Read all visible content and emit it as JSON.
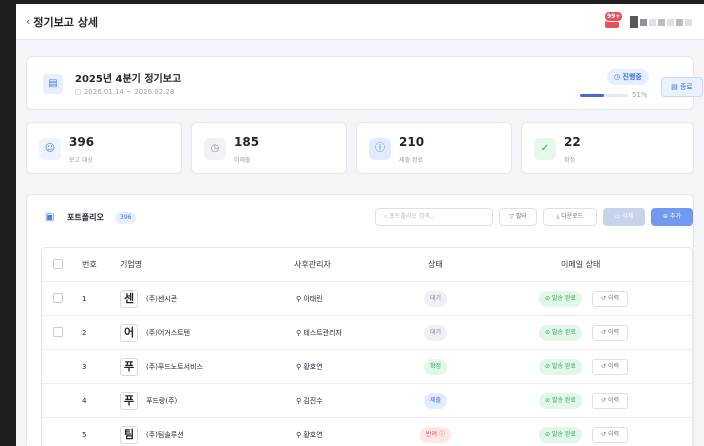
{
  "header": {
    "back_glyph": "‹",
    "title": "정기보고 상세",
    "notification_count": "99+"
  },
  "report": {
    "title": "2025년 4분기 정기보고",
    "date_range": "2026.01.14 ~ 2026.02.28",
    "status": "진행중",
    "progress_percent": 51,
    "progress_text": "51%",
    "end_label": "종료"
  },
  "stats": [
    {
      "value": "396",
      "label": "보고 대상",
      "icon": "users-icon",
      "bg": "#eef3ff",
      "fg": "#4a7ee8"
    },
    {
      "value": "185",
      "label": "미제출",
      "icon": "clock-icon",
      "bg": "#f1f2f5",
      "fg": "#8a909b"
    },
    {
      "value": "210",
      "label": "제출 완료",
      "icon": "alert-icon",
      "bg": "#e3ecff",
      "fg": "#3b6fe0"
    },
    {
      "value": "22",
      "label": "확정",
      "icon": "check-icon",
      "bg": "#e6f7ec",
      "fg": "#2fa65a"
    }
  ],
  "portfolio": {
    "title": "포트폴리오",
    "count": "396",
    "search_placeholder": "포트폴리오 검색...",
    "filter_label": "필터",
    "download_label": "다운로드",
    "delete_label": "삭제",
    "add_label": "추가",
    "columns": {
      "number": "번호",
      "company": "기업명",
      "manager": "사후관리자",
      "status": "상태",
      "email_status": "이메일 상태"
    },
    "rows": [
      {
        "no": "1",
        "logo": "센",
        "company": "(주)센시콘",
        "manager": "이태린",
        "status": "대기",
        "email": "발송 완료",
        "history": "이력"
      },
      {
        "no": "2",
        "logo": "어",
        "company": "(주)어거스트텐",
        "manager": "테스트관리자",
        "status": "대기",
        "email": "발송 완료",
        "history": "이력"
      },
      {
        "no": "3",
        "logo": "푸",
        "company": "(주)푸드노트서비스",
        "manager": "황호연",
        "status": "확정",
        "email": "발송 완료",
        "history": "이력"
      },
      {
        "no": "4",
        "logo": "푸",
        "company": "푸드랑(주)",
        "manager": "김진수",
        "status": "제출",
        "email": "발송 완료",
        "history": "이력"
      },
      {
        "no": "5",
        "logo": "팀",
        "company": "(주)팀솔루션",
        "manager": "황호연",
        "status": "반려",
        "email": "발송 완료",
        "history": "이력"
      }
    ]
  },
  "colors": {
    "accent": "#3b6fe0",
    "status_wait_bg": "#eef0f6",
    "status_wait_fg": "#7b8190",
    "status_confirm_bg": "#e3f6ea",
    "status_confirm_fg": "#2fa65a",
    "status_submit_bg": "#e3ecff",
    "status_submit_fg": "#3b6fe0",
    "status_reject_bg": "#fde8e8",
    "status_reject_fg": "#e04848"
  }
}
